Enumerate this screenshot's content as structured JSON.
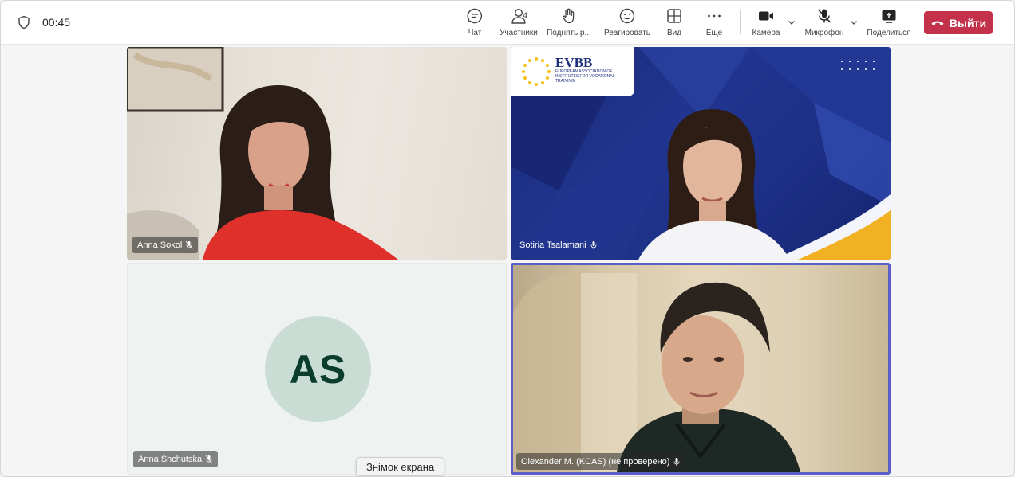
{
  "call": {
    "timer": "00:45"
  },
  "toolbar": {
    "chat": "Чат",
    "participants": "Участники",
    "participants_count": "4",
    "raise_hand": "Поднять р...",
    "react": "Реагировать",
    "view": "Вид",
    "more": "Еще",
    "camera": "Камера",
    "mic": "Микрофон",
    "share": "Поделиться",
    "leave": "Выйти"
  },
  "participants": [
    {
      "name": "Anna Sokol"
    },
    {
      "name": "Sotiria Tsalamani"
    },
    {
      "name": "Anna Shchutska",
      "initials": "AS"
    },
    {
      "name": "Olexander M. (KCAS) (не проверено)"
    }
  ],
  "logo": {
    "title": "EVBB",
    "subtitle": "EUROPEAN ASSOCIATION OF INSTITUTES FOR VOCATIONAL TRAINING"
  },
  "toast": "Знімок екрана",
  "colors": {
    "leave": "#c4314b",
    "active_speaker": "#5b5fc7"
  }
}
